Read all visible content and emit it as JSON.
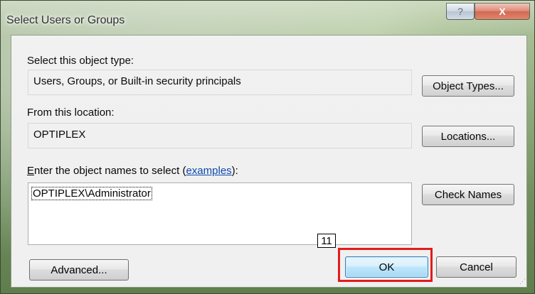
{
  "window": {
    "title": "Select Users or Groups",
    "help_label": "?",
    "close_label": "X"
  },
  "object_type": {
    "label": "Select this object type:",
    "value": "Users, Groups, or Built-in security principals",
    "button": "Object Types..."
  },
  "location": {
    "label": "From this location:",
    "value": "OPTIPLEX",
    "button": "Locations..."
  },
  "names": {
    "label_prefix": "Enter the object names to select (",
    "label_access_key": "E",
    "label_rest": "nter the object names to select (",
    "link": "examples",
    "label_suffix": "):",
    "value": "OPTIPLEX\\Administrator",
    "check_button": "Check Names"
  },
  "footer": {
    "advanced_button": "Advanced...",
    "ok_button": "OK",
    "cancel_button": "Cancel"
  },
  "annotation": {
    "step_number": "11",
    "highlight_color": "#e21b1b"
  }
}
